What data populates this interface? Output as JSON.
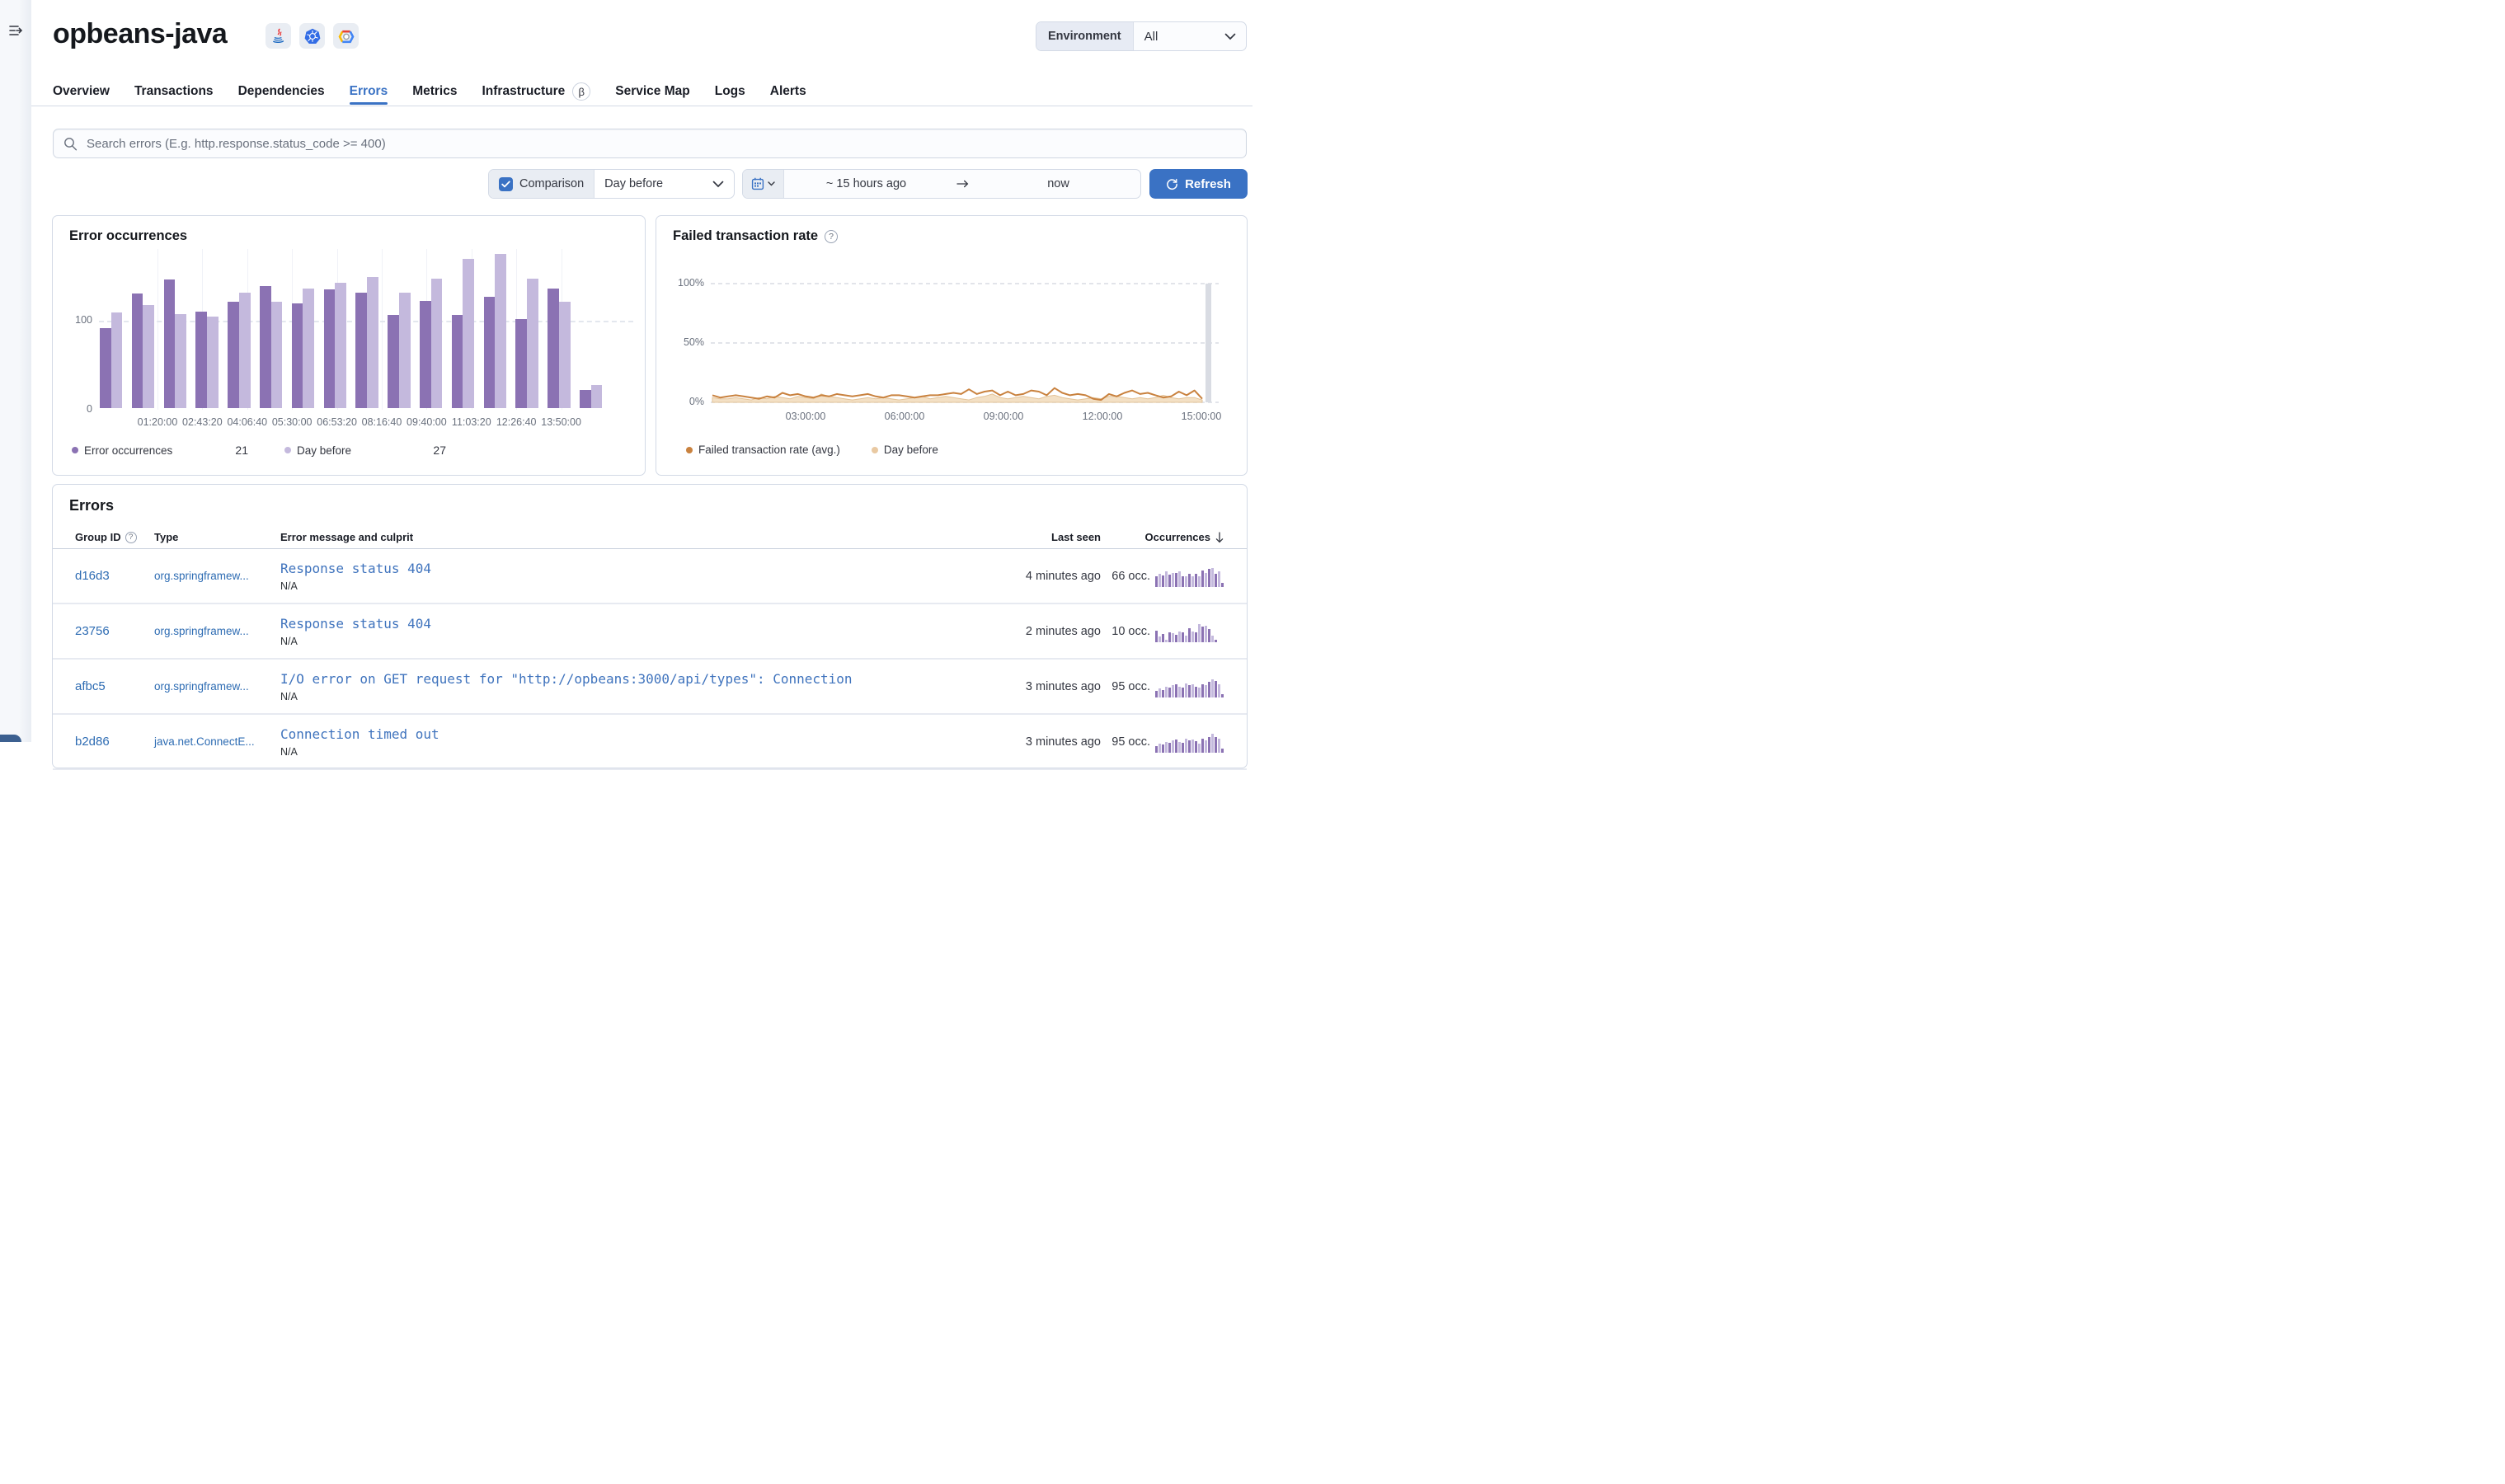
{
  "header": {
    "service_name": "opbeans-java",
    "agent_icons": [
      "java-icon",
      "kubernetes-icon",
      "google-cloud-icon"
    ],
    "environment_label": "Environment",
    "environment_value": "All"
  },
  "tabs": [
    {
      "label": "Overview"
    },
    {
      "label": "Transactions"
    },
    {
      "label": "Dependencies"
    },
    {
      "label": "Errors",
      "active": true
    },
    {
      "label": "Metrics"
    },
    {
      "label": "Infrastructure",
      "beta": true
    },
    {
      "label": "Service Map"
    },
    {
      "label": "Logs"
    },
    {
      "label": "Alerts"
    }
  ],
  "search": {
    "placeholder": "Search errors (E.g. http.response.status_code >= 400)"
  },
  "controls": {
    "comparison_label": "Comparison",
    "comparison_checked": true,
    "comparison_value": "Day before",
    "time_start": "~ 15 hours ago",
    "time_end": "now",
    "refresh_label": "Refresh"
  },
  "colors": {
    "primary": "#3a72c4",
    "link": "#2e6cb3",
    "bar_current": "#8b72b3",
    "bar_previous": "#c4b9dd",
    "line_current": "#c9823f",
    "line_previous_fill": "#f3e0c5",
    "line_previous_stroke": "#e3c398",
    "annotation_bar": "#d9dce3"
  },
  "chart_data": [
    {
      "type": "bar",
      "title": "Error occurrences",
      "x_ticks": [
        "01:20:00",
        "02:43:20",
        "04:06:40",
        "05:30:00",
        "06:53:20",
        "08:16:40",
        "09:40:00",
        "11:03:20",
        "12:26:40",
        "13:50:00"
      ],
      "y_ticks": [
        "0",
        "100"
      ],
      "ymax": 180,
      "grid": true,
      "legend_position": "bottom",
      "series": [
        {
          "name": "Error occurrences",
          "legend_value": 21,
          "color": "#8b72b3",
          "values": [
            90,
            129,
            144,
            108,
            119,
            137,
            118,
            133,
            130,
            105,
            120,
            105,
            125,
            100,
            134,
            20
          ]
        },
        {
          "name": "Day before",
          "legend_value": 27,
          "color": "#c4b9dd",
          "values": [
            107,
            116,
            106,
            103,
            130,
            119,
            134,
            141,
            147,
            130,
            145,
            168,
            173,
            145,
            119,
            26
          ]
        }
      ]
    },
    {
      "type": "line",
      "title": "Failed transaction rate",
      "x_ticks": [
        "03:00:00",
        "06:00:00",
        "09:00:00",
        "12:00:00",
        "15:00:00"
      ],
      "y_ticks": [
        "0%",
        "50%",
        "100%"
      ],
      "ylim": [
        0,
        100
      ],
      "grid": true,
      "legend_position": "bottom",
      "series": [
        {
          "name": "Failed transaction rate (avg.)",
          "color": "#c9823f",
          "values": [
            6,
            4,
            5,
            6,
            5,
            4,
            3,
            5,
            4,
            8,
            6,
            7,
            5,
            4,
            6,
            5,
            7,
            6,
            5,
            6,
            7,
            5,
            4,
            6,
            6,
            5,
            4,
            5,
            6,
            6,
            7,
            8,
            7,
            11,
            7,
            9,
            10,
            6,
            9,
            6,
            7,
            10,
            9,
            6,
            12,
            8,
            6,
            7,
            6,
            3,
            2,
            7,
            5,
            8,
            10,
            7,
            8,
            6,
            4,
            5,
            9,
            6,
            10,
            3
          ]
        },
        {
          "name": "Day before",
          "color": "#e9c9a2",
          "values": [
            4,
            3,
            3,
            4,
            3,
            2,
            4,
            3,
            5,
            4,
            3,
            5,
            4,
            3,
            7,
            5,
            4,
            3,
            2,
            3,
            4,
            3,
            4,
            3,
            2,
            3,
            4,
            5,
            3,
            4,
            5,
            4,
            3,
            2,
            4,
            5,
            7,
            4,
            3,
            4,
            5,
            4,
            3,
            5,
            6,
            4,
            3,
            2,
            3,
            4,
            3,
            5,
            5,
            4,
            3,
            4,
            3,
            4,
            6,
            4,
            3,
            4,
            4,
            2
          ]
        }
      ]
    }
  ],
  "errors_panel": {
    "title": "Errors",
    "columns": [
      "Group ID",
      "Type",
      "Error message and culprit",
      "Last seen",
      "Occurrences"
    ],
    "rows": [
      {
        "group_id": "d16d3",
        "type": "org.springframew...",
        "message": "Response status 404",
        "culprit": "N/A",
        "last_seen": "4 minutes ago",
        "occurrences": "66 occ.",
        "spark": [
          48,
          60,
          52,
          70,
          56,
          62,
          64,
          70,
          50,
          48,
          58,
          50,
          60,
          48,
          74,
          62,
          82,
          86,
          60,
          72,
          16
        ]
      },
      {
        "group_id": "23756",
        "type": "org.springframew...",
        "message": "Response status 404",
        "culprit": "N/A",
        "last_seen": "2 minutes ago",
        "occurrences": "10 occ.",
        "spark": [
          52,
          26,
          36,
          8,
          44,
          40,
          34,
          50,
          44,
          30,
          64,
          50,
          44,
          84,
          70,
          74,
          60,
          30,
          8
        ]
      },
      {
        "group_id": "afbc5",
        "type": "org.springframew...",
        "message": "I/O error on GET request for \"http://opbeans:3000/api/types\": Connection",
        "culprit": "N/A",
        "last_seen": "3 minutes ago",
        "occurrences": "95 occ.",
        "spark": [
          30,
          40,
          34,
          50,
          44,
          54,
          60,
          50,
          44,
          64,
          54,
          60,
          50,
          44,
          60,
          54,
          70,
          84,
          74,
          60,
          14
        ]
      },
      {
        "group_id": "b2d86",
        "type": "java.net.ConnectE...",
        "message": "Connection timed out",
        "culprit": "N/A",
        "last_seen": "3 minutes ago",
        "occurrences": "95 occ.",
        "spark": [
          28,
          42,
          36,
          48,
          46,
          56,
          58,
          48,
          46,
          62,
          56,
          58,
          52,
          42,
          62,
          56,
          72,
          86,
          72,
          62,
          16
        ]
      }
    ]
  }
}
